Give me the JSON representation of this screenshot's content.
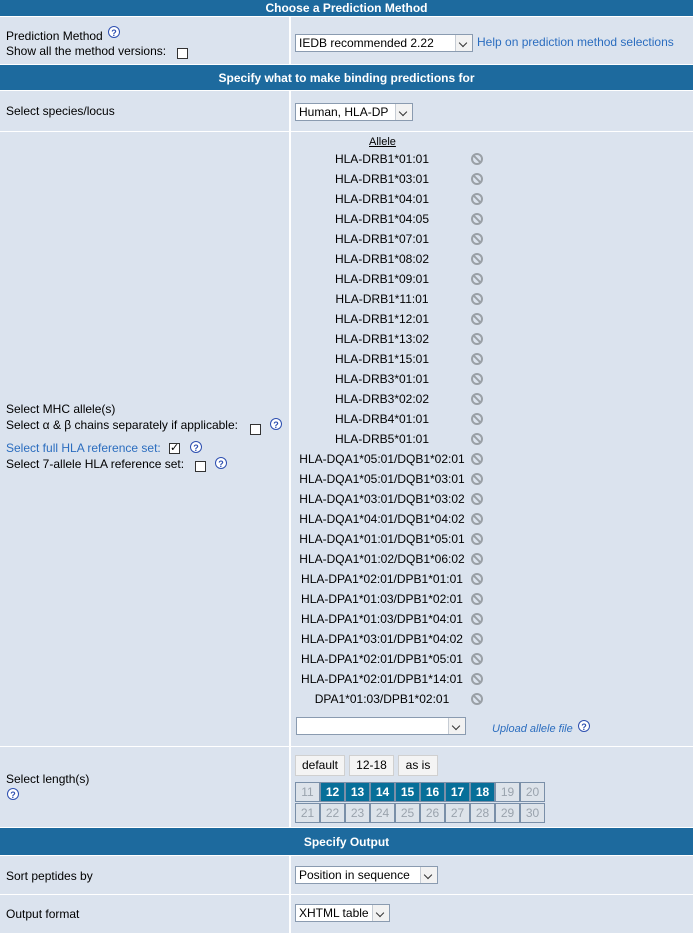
{
  "sections": {
    "choose_method": "Choose a Prediction Method",
    "binding": "Specify what to make binding predictions for",
    "output": "Specify Output"
  },
  "method": {
    "label": "Prediction Method",
    "versions_label": "Show all the method versions:",
    "selected": "IEDB recommended 2.22",
    "help_link": "Help on prediction method selections"
  },
  "species": {
    "label": "Select species/locus",
    "selected": "Human, HLA-DP"
  },
  "mhc": {
    "label": "Select MHC allele(s)",
    "chains_label": "Select α & β chains separately if applicable:",
    "full_ref_label": "Select full HLA reference set:",
    "seven_ref_label": "Select 7-allele HLA reference set:",
    "allele_header": "Allele",
    "add_select_value": "",
    "upload_link": "Upload allele file",
    "alleles": [
      "HLA-DRB1*01:01",
      "HLA-DRB1*03:01",
      "HLA-DRB1*04:01",
      "HLA-DRB1*04:05",
      "HLA-DRB1*07:01",
      "HLA-DRB1*08:02",
      "HLA-DRB1*09:01",
      "HLA-DRB1*11:01",
      "HLA-DRB1*12:01",
      "HLA-DRB1*13:02",
      "HLA-DRB1*15:01",
      "HLA-DRB3*01:01",
      "HLA-DRB3*02:02",
      "HLA-DRB4*01:01",
      "HLA-DRB5*01:01",
      "HLA-DQA1*05:01/DQB1*02:01",
      "HLA-DQA1*05:01/DQB1*03:01",
      "HLA-DQA1*03:01/DQB1*03:02",
      "HLA-DQA1*04:01/DQB1*04:02",
      "HLA-DQA1*01:01/DQB1*05:01",
      "HLA-DQA1*01:02/DQB1*06:02",
      "HLA-DPA1*02:01/DPB1*01:01",
      "HLA-DPA1*01:03/DPB1*02:01",
      "HLA-DPA1*01:03/DPB1*04:01",
      "HLA-DPA1*03:01/DPB1*04:02",
      "HLA-DPA1*02:01/DPB1*05:01",
      "HLA-DPA1*02:01/DPB1*14:01",
      "DPA1*01:03/DPB1*02:01"
    ]
  },
  "length": {
    "label": "Select length(s)",
    "buttons": [
      "default",
      "12-18",
      "as is"
    ],
    "row1": [
      "11",
      "12",
      "13",
      "14",
      "15",
      "16",
      "17",
      "18",
      "19",
      "20"
    ],
    "row2": [
      "21",
      "22",
      "23",
      "24",
      "25",
      "26",
      "27",
      "28",
      "29",
      "30"
    ],
    "selected": [
      "12",
      "13",
      "14",
      "15",
      "16",
      "17",
      "18"
    ]
  },
  "sort": {
    "label": "Sort peptides by",
    "selected": "Position in sequence"
  },
  "output_format": {
    "label": "Output format",
    "selected": "XHTML table"
  },
  "colors": {
    "header_bg": "#1d6a9e",
    "cell_bg": "#dbe3ee",
    "selected_length_bg": "#076f99",
    "link": "#2b6dbf"
  }
}
